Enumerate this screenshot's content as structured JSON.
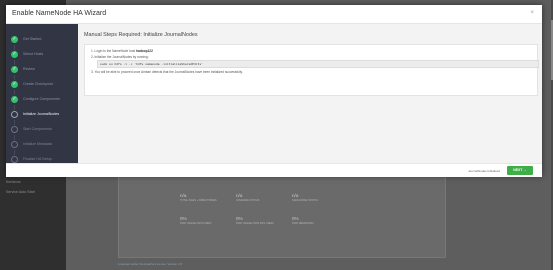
{
  "background": {
    "sidebar_items": [
      "Kerberos",
      "Service Auto Start"
    ],
    "cards_top": [
      {
        "value": "n/a",
        "label": "TOTAL FILES + DIRECTORIES"
      },
      {
        "value": "n/a",
        "label": "UPGRADE STATUS"
      },
      {
        "value": "n/a",
        "label": "SAFE MODE STATUS"
      }
    ],
    "cards_bottom": [
      {
        "value": "0%",
        "label": "DISK USAGE (DFS USED)"
      },
      {
        "value": "0%",
        "label": "DISK USAGE (NON DFS USED)"
      },
      {
        "value": "0%",
        "label": "DISK REMAINING"
      }
    ],
    "link": "Licensed under the Apache License, Version 2.0"
  },
  "modal": {
    "title": "Enable NameNode HA Wizard",
    "close": "×",
    "steps": [
      {
        "label": "Get Started",
        "state": "done",
        "icon": "check-icon",
        "glyph": "✓"
      },
      {
        "label": "Select Hosts",
        "state": "done",
        "icon": "check-icon",
        "glyph": "✓"
      },
      {
        "label": "Review",
        "state": "done",
        "icon": "check-icon",
        "glyph": "✓"
      },
      {
        "label": "Create Checkpoint",
        "state": "done",
        "icon": "check-icon",
        "glyph": "✓"
      },
      {
        "label": "Configure Components",
        "state": "done",
        "icon": "check-icon",
        "glyph": "✓"
      },
      {
        "label": "Initialize JournalNodes",
        "state": "active",
        "icon": "circle-icon",
        "glyph": ""
      },
      {
        "label": "Start Components",
        "state": "pending",
        "icon": "circle-icon",
        "glyph": ""
      },
      {
        "label": "Initialize Metadata",
        "state": "pending",
        "icon": "circle-icon",
        "glyph": ""
      },
      {
        "label": "Finalize HA Setup",
        "state": "pending",
        "icon": "circle-icon",
        "glyph": ""
      }
    ],
    "content_title": "Manual Steps Required: Initialize JournalNodes",
    "instructions": {
      "step1_prefix": "1. Login to the NameNode host ",
      "step1_host": "hadoop122",
      "step2": "2. Initialize the JournalNodes by running:",
      "command": "sudo su hdfs -l -c 'hdfs namenode -initializeSharedEdits'",
      "step3": "3. You will be able to proceed once Ambari detects that the JournalNodes have been initialized successfully."
    },
    "footer": {
      "status": "JournalNodes Initialized",
      "next_label": "NEXT →"
    }
  }
}
